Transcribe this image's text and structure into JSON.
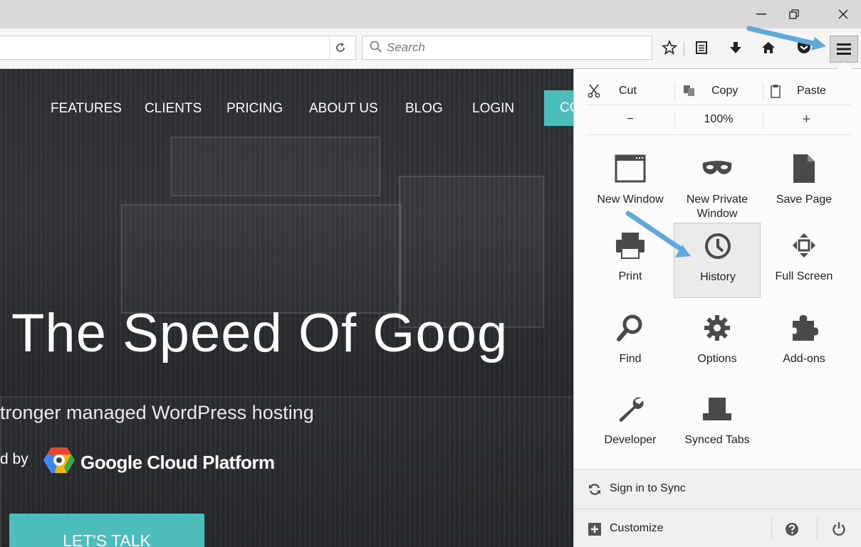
{
  "window_controls": {
    "minimize": "—",
    "restore": "❐",
    "close": "✕"
  },
  "navbar": {
    "search_placeholder": "Search",
    "icons": [
      "bookmark-star-icon",
      "reading-list-icon",
      "download-icon",
      "home-icon",
      "pocket-icon",
      "hamburger-menu-icon"
    ]
  },
  "page": {
    "nav": [
      "FEATURES",
      "CLIENTS",
      "PRICING",
      "ABOUT US",
      "BLOG",
      "LOGIN"
    ],
    "top_cta": "CO",
    "hero_title": "The Speed Of Goog",
    "hero_subtitle": "tronger managed WordPress hosting",
    "powered_by": "d by",
    "partner": "Google Cloud Platform",
    "bottom_cta": "LET'S TALK"
  },
  "menu": {
    "edit": {
      "cut": "Cut",
      "copy": "Copy",
      "paste": "Paste"
    },
    "zoom": {
      "out": "−",
      "level": "100%",
      "in": "+"
    },
    "items": [
      {
        "label": "New Window",
        "icon": "window-icon"
      },
      {
        "label": "New Private Window",
        "icon": "mask-icon"
      },
      {
        "label": "Save Page",
        "icon": "page-icon"
      },
      {
        "label": "Print",
        "icon": "printer-icon"
      },
      {
        "label": "History",
        "icon": "clock-icon",
        "selected": true
      },
      {
        "label": "Full Screen",
        "icon": "fullscreen-icon"
      },
      {
        "label": "Find",
        "icon": "magnifier-icon"
      },
      {
        "label": "Options",
        "icon": "gear-icon"
      },
      {
        "label": "Add-ons",
        "icon": "puzzle-icon"
      },
      {
        "label": "Developer",
        "icon": "wrench-icon"
      },
      {
        "label": "Synced Tabs",
        "icon": "synced-tabs-icon"
      }
    ],
    "sync": "Sign in to Sync",
    "customize": "Customize"
  },
  "colors": {
    "accent": "#4dbdbb",
    "panel": "#fbfbfb",
    "annotation_arrow": "#5fa8d8"
  }
}
